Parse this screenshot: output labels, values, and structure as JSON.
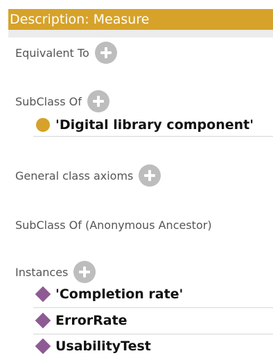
{
  "header": {
    "title": "Description: Measure"
  },
  "sections": {
    "equivalent_to": {
      "label": "Equivalent To"
    },
    "subclass_of": {
      "label": "SubClass Of",
      "items": [
        "'Digital library component'"
      ]
    },
    "general_class_axioms": {
      "label": "General class axioms"
    },
    "subclass_of_anonymous": {
      "label": "SubClass Of (Anonymous Ancestor)"
    },
    "instances": {
      "label": "Instances",
      "items": [
        "'Completion rate'",
        "ErrorRate",
        "UsabilityTest"
      ]
    }
  },
  "colors": {
    "header_bg": "#d6a22a",
    "class_icon": "#d6a22a",
    "individual_icon": "#8e5a93",
    "add_button": "#bdbdbd"
  },
  "icons": {
    "add": "plus-circle-icon",
    "class": "class-circle-icon",
    "individual": "individual-diamond-icon"
  }
}
